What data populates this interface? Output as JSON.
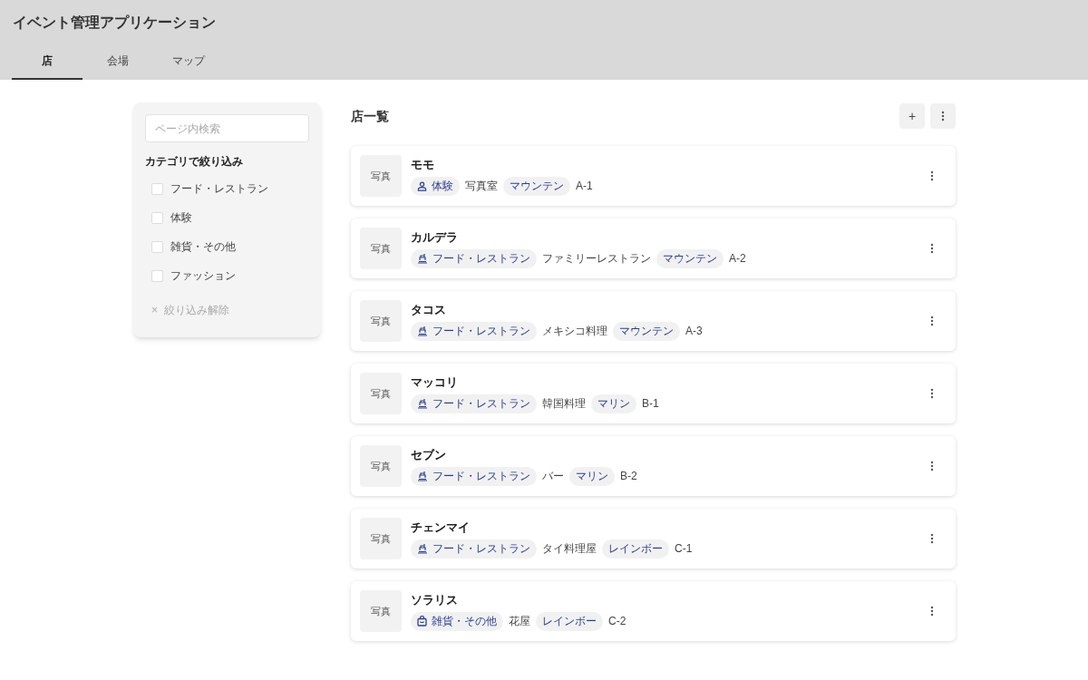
{
  "app": {
    "title": "イベント管理アプリケーション"
  },
  "tabs": [
    {
      "label": "店",
      "selected": true
    },
    {
      "label": "会場",
      "selected": false
    },
    {
      "label": "マップ",
      "selected": false
    }
  ],
  "sidebar": {
    "search": {
      "placeholder": "ページ内検索"
    },
    "filter_title": "カテゴリで絞り込み",
    "categories": [
      {
        "label": "フード・レストラン",
        "checked": false
      },
      {
        "label": "体験",
        "checked": false
      },
      {
        "label": "雑貨・その他",
        "checked": false
      },
      {
        "label": "ファッション",
        "checked": false
      }
    ],
    "clear": {
      "icon": "×",
      "label": "絞り込み解除"
    }
  },
  "list": {
    "title": "店一覧",
    "add_icon": "+",
    "shops": [
      {
        "photo": "写真",
        "name": "モモ",
        "category": {
          "kind": "experience",
          "label": "体験"
        },
        "genre": "写真室",
        "area": "マウンテン",
        "booth": "A-1"
      },
      {
        "photo": "写真",
        "name": "カルデラ",
        "category": {
          "kind": "food",
          "label": "フード・レストラン"
        },
        "genre": "ファミリーレストラン",
        "area": "マウンテン",
        "booth": "A-2"
      },
      {
        "photo": "写真",
        "name": "タコス",
        "category": {
          "kind": "food",
          "label": "フード・レストラン"
        },
        "genre": "メキシコ料理",
        "area": "マウンテン",
        "booth": "A-3"
      },
      {
        "photo": "写真",
        "name": "マッコリ",
        "category": {
          "kind": "food",
          "label": "フード・レストラン"
        },
        "genre": "韓国料理",
        "area": "マリン",
        "booth": "B-1"
      },
      {
        "photo": "写真",
        "name": "セブン",
        "category": {
          "kind": "food",
          "label": "フード・レストラン"
        },
        "genre": "バー",
        "area": "マリン",
        "booth": "B-2"
      },
      {
        "photo": "写真",
        "name": "チェンマイ",
        "category": {
          "kind": "food",
          "label": "フード・レストラン"
        },
        "genre": "タイ料理屋",
        "area": "レインボー",
        "booth": "C-1"
      },
      {
        "photo": "写真",
        "name": "ソラリス",
        "category": {
          "kind": "goods",
          "label": "雑貨・その他"
        },
        "genre": "花屋",
        "area": "レインボー",
        "booth": "C-2"
      }
    ]
  }
}
